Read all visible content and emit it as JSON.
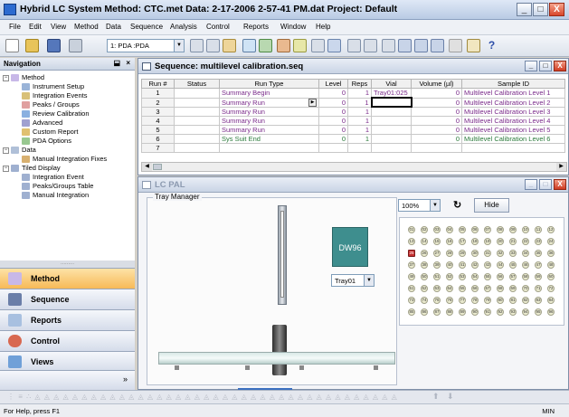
{
  "window": {
    "title": "Hybrid LC System     Method: CTC.met     Data: 2-17-2006 2-57-41 PM.dat     Project: Default",
    "min_label": "_",
    "max_label": "□",
    "close_label": "X"
  },
  "menu": [
    "File",
    "Edit",
    "View",
    "Method",
    "Data",
    "Sequence",
    "Analysis",
    "Control",
    "Reports",
    "Window",
    "Help"
  ],
  "toolbar": {
    "instrument_value": "1: PDA :PDA",
    "help_glyph": "?"
  },
  "navigation": {
    "title": "Navigation",
    "pin": "⬓",
    "close": "×",
    "tree": [
      {
        "label": "Method",
        "level": 0,
        "expander": "−"
      },
      {
        "label": "Instrument Setup",
        "level": 1
      },
      {
        "label": "Integration Events",
        "level": 1
      },
      {
        "label": "Peaks / Groups",
        "level": 1
      },
      {
        "label": "Review Calibration",
        "level": 1
      },
      {
        "label": "Advanced",
        "level": 1
      },
      {
        "label": "Custom Report",
        "level": 1
      },
      {
        "label": "PDA Options",
        "level": 1
      },
      {
        "label": "Data",
        "level": 0,
        "expander": "−"
      },
      {
        "label": "Manual Integration Fixes",
        "level": 1
      },
      {
        "label": "Tiled Display",
        "level": 0,
        "expander": "−"
      },
      {
        "label": "Integration Event",
        "level": 1
      },
      {
        "label": "Peaks/Groups Table",
        "level": 1
      },
      {
        "label": "Manual Integration",
        "level": 1
      }
    ],
    "buttons": [
      "Method",
      "Sequence",
      "Reports",
      "Control",
      "Views"
    ],
    "more": "»"
  },
  "sequence": {
    "title": "Sequence: multilevel calibration.seq",
    "columns": [
      "Run #",
      "Status",
      "Run Type",
      "Level",
      "Reps",
      "Vial",
      "Volume (µl)",
      "Sample ID"
    ],
    "rows": [
      {
        "run": "1",
        "status": "",
        "type": "Summary Begin",
        "level": "0",
        "reps": "1",
        "vial": "Tray01:025",
        "volume": "0",
        "sample": "Multilevel Calibration Level 1"
      },
      {
        "run": "2",
        "status": "",
        "type": "Summary Run",
        "level": "0",
        "reps": "1",
        "vial": "",
        "volume": "0",
        "sample": "Multilevel Calibration Level 2"
      },
      {
        "run": "3",
        "status": "",
        "type": "Summary Run",
        "level": "0",
        "reps": "1",
        "vial": "",
        "volume": "0",
        "sample": "Multilevel Calibration Level 3"
      },
      {
        "run": "4",
        "status": "",
        "type": "Summary Run",
        "level": "0",
        "reps": "1",
        "vial": "",
        "volume": "0",
        "sample": "Multilevel Calibration Level 4"
      },
      {
        "run": "5",
        "status": "",
        "type": "Summary Run",
        "level": "0",
        "reps": "1",
        "vial": "",
        "volume": "0",
        "sample": "Multilevel Calibration Level 5"
      },
      {
        "run": "6",
        "status": "",
        "type": "Sys Suit End",
        "level": "0",
        "reps": "1",
        "vial": "",
        "volume": "0",
        "sample": "Multilevel Calibration Level 6"
      },
      {
        "run": "7",
        "status": "",
        "type": "",
        "level": "",
        "reps": "",
        "vial": "",
        "volume": "",
        "sample": ""
      }
    ]
  },
  "lcpal": {
    "title": "LC PAL",
    "tray_manager_label": "Tray Manager",
    "tray_type": "DW96",
    "tray_select": "Tray01",
    "zoom": "100%",
    "hide_label": "Hide",
    "refresh_glyph": "↻",
    "well_rows": [
      [
        "01",
        "02",
        "03",
        "04",
        "05",
        "06",
        "07",
        "08",
        "09",
        "10",
        "11",
        "12"
      ],
      [
        "13",
        "14",
        "15",
        "16",
        "17",
        "18",
        "19",
        "20",
        "21",
        "22",
        "23",
        "24"
      ],
      [
        "25",
        "26",
        "27",
        "28",
        "29",
        "30",
        "31",
        "32",
        "33",
        "34",
        "35",
        "36"
      ],
      [
        "37",
        "38",
        "39",
        "40",
        "41",
        "42",
        "43",
        "44",
        "45",
        "46",
        "47",
        "48"
      ],
      [
        "49",
        "50",
        "51",
        "52",
        "53",
        "54",
        "55",
        "56",
        "57",
        "58",
        "59",
        "60"
      ],
      [
        "61",
        "62",
        "63",
        "64",
        "65",
        "66",
        "67",
        "68",
        "69",
        "70",
        "71",
        "72"
      ],
      [
        "73",
        "74",
        "75",
        "76",
        "77",
        "78",
        "79",
        "80",
        "81",
        "82",
        "83",
        "84"
      ],
      [
        "85",
        "86",
        "87",
        "88",
        "89",
        "90",
        "91",
        "92",
        "93",
        "94",
        "95",
        "96"
      ]
    ],
    "selected_well": "25"
  },
  "status": {
    "text": "For Help, press F1",
    "mode": "MIN"
  },
  "colors": {
    "accent": "#f7b957",
    "tray_badge": "#3e8e8e",
    "selected_well": "#c63030"
  }
}
